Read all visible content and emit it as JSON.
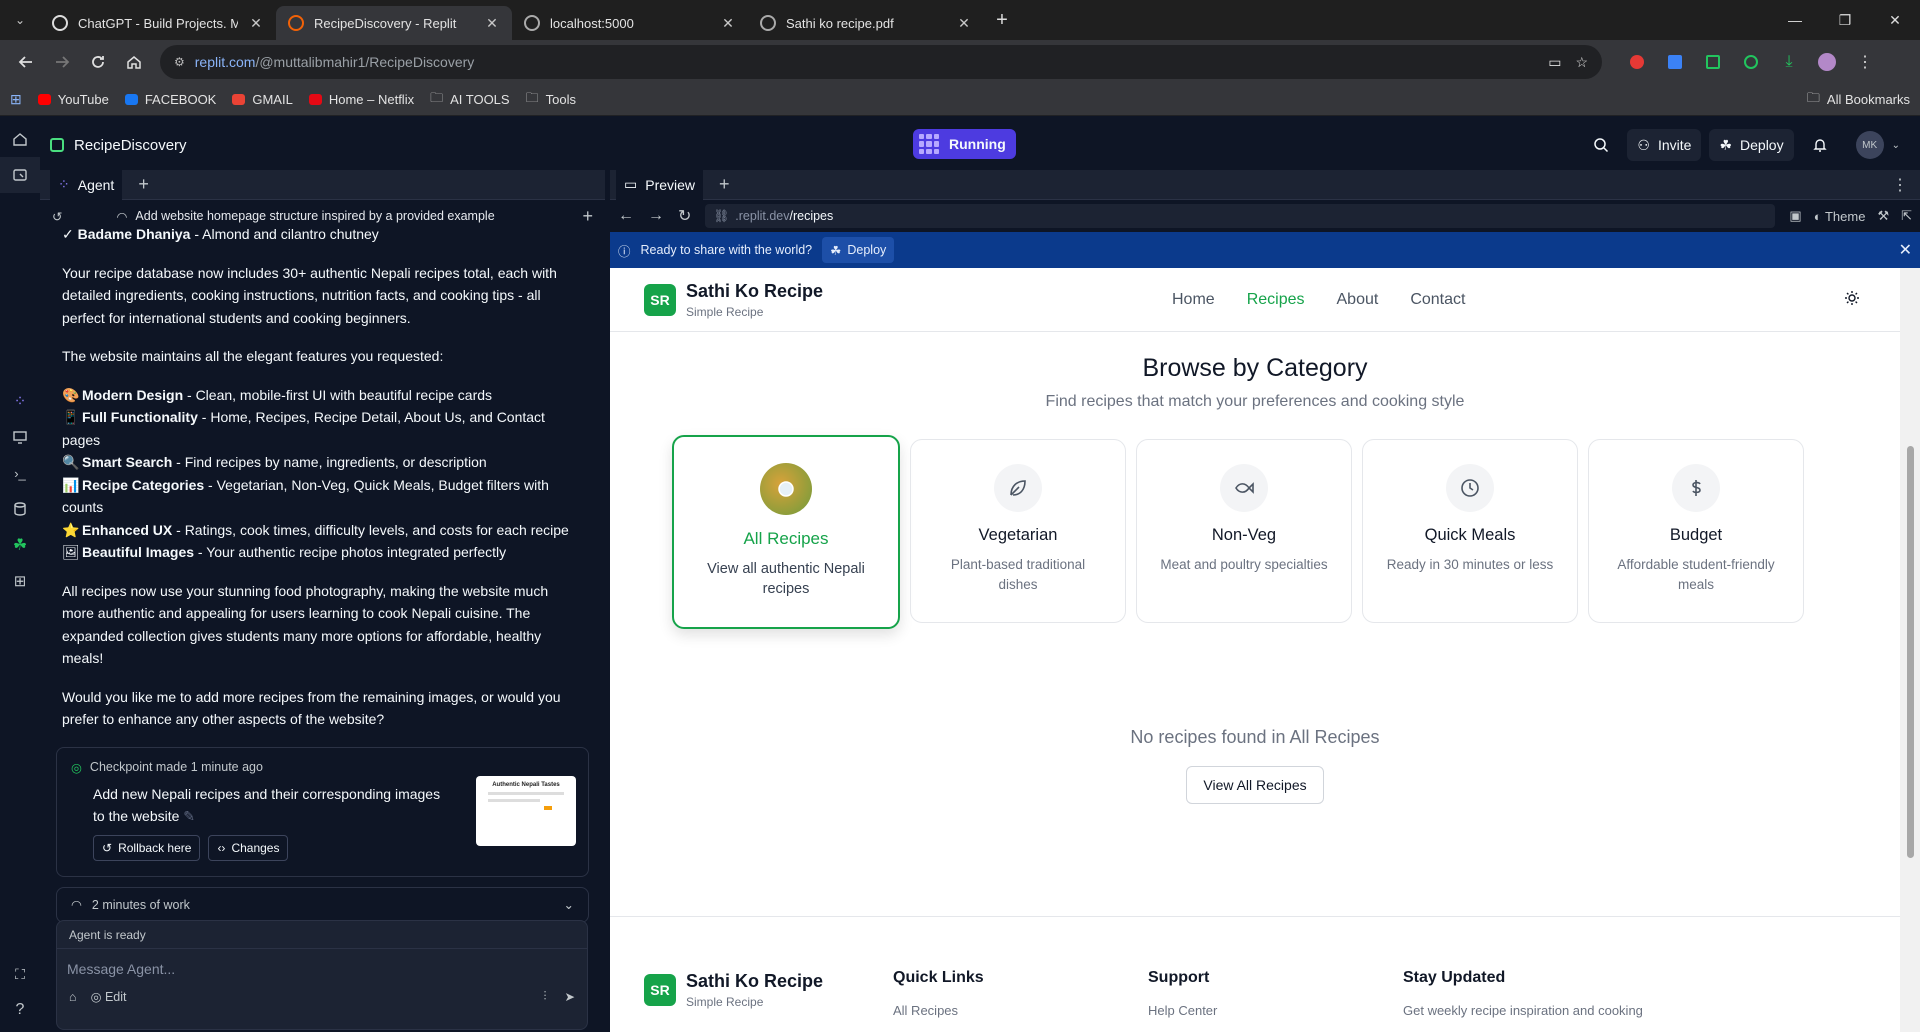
{
  "browser": {
    "tabs": [
      {
        "title": "ChatGPT - Build Projects. Mahir",
        "active": false,
        "favicon": "chatgpt-icon"
      },
      {
        "title": "RecipeDiscovery - Replit",
        "active": true,
        "favicon": "replit-icon"
      },
      {
        "title": "localhost:5000",
        "active": false,
        "favicon": "globe-icon"
      },
      {
        "title": "Sathi ko recipe.pdf",
        "active": false,
        "favicon": "globe-icon"
      }
    ],
    "url_host": "replit.com",
    "url_path": "/@muttalibmahir1/RecipeDiscovery",
    "bookmarks": [
      {
        "label": "YouTube",
        "icon": "youtube-icon"
      },
      {
        "label": "FACEBOOK",
        "icon": "facebook-icon"
      },
      {
        "label": "GMAIL",
        "icon": "gmail-icon"
      },
      {
        "label": "Home – Netflix",
        "icon": "netflix-icon"
      },
      {
        "label": "AI TOOLS",
        "icon": "folder-icon"
      },
      {
        "label": "Tools",
        "icon": "folder-icon"
      }
    ],
    "all_bookmarks": "All Bookmarks"
  },
  "replit": {
    "project_name": "RecipeDiscovery",
    "status": "Running",
    "invite": "Invite",
    "deploy": "Deploy",
    "avatar": "MK"
  },
  "agent": {
    "tab_label": "Agent",
    "thread_title": "Add website homepage structure inspired by a provided example",
    "message": {
      "first_line_bold": "Badame Dhaniya",
      "first_line_rest": " - Almond and cilantro chutney",
      "p1": "Your recipe database now includes 30+ authentic Nepali recipes total, each with detailed ingredients, cooking instructions, nutrition facts, and cooking tips - all perfect for international students and cooking beginners.",
      "p2": "The website maintains all the elegant features you requested:",
      "features": [
        {
          "emoji": "🎨",
          "title": "Modern Design",
          "text": " - Clean, mobile-first UI with beautiful recipe cards"
        },
        {
          "emoji": "📱",
          "title": "Full Functionality",
          "text": " - Home, Recipes, Recipe Detail, About Us, and Contact pages"
        },
        {
          "emoji": "🔍",
          "title": "Smart Search",
          "text": " - Find recipes by name, ingredients, or description"
        },
        {
          "emoji": "📊",
          "title": "Recipe Categories",
          "text": " - Vegetarian, Non-Veg, Quick Meals, Budget filters with counts"
        },
        {
          "emoji": "⭐",
          "title": "Enhanced UX",
          "text": " - Ratings, cook times, difficulty levels, and costs for each recipe"
        },
        {
          "emoji": "🖼",
          "title": "Beautiful Images",
          "text": " - Your authentic recipe photos integrated perfectly"
        }
      ],
      "p3": "All recipes now use your stunning food photography, making the website much more authentic and appealing for users learning to cook Nepali cuisine. The expanded collection gives students many more options for affordable, healthy meals!",
      "p4": "Would you like me to add more recipes from the remaining images, or would you prefer to enhance any other aspects of the website?"
    },
    "checkpoint": {
      "label": "Checkpoint made",
      "time": "1 minute ago",
      "text": "Add new Nepali recipes and their corresponding images to the website",
      "rollback": "Rollback here",
      "changes": "Changes",
      "thumb_title": "Authentic Nepali Tastes"
    },
    "work": "2 minutes of work",
    "ready": "Agent is ready",
    "input_placeholder": "Message Agent...",
    "edit": "Edit"
  },
  "preview": {
    "tab_label": "Preview",
    "url_prefix": ".replit.dev",
    "url_path": "/recipes",
    "theme": "Theme",
    "banner_text": "Ready to share with the world?",
    "banner_deploy": "Deploy"
  },
  "site": {
    "logo": "SR",
    "name": "Sathi Ko Recipe",
    "tagline": "Simple Recipe",
    "nav": [
      {
        "label": "Home",
        "active": false
      },
      {
        "label": "Recipes",
        "active": true
      },
      {
        "label": "About",
        "active": false
      },
      {
        "label": "Contact",
        "active": false
      }
    ],
    "browse_title": "Browse by Category",
    "browse_subtitle": "Find recipes that match your preferences and cooking style",
    "categories": [
      {
        "title": "All Recipes",
        "desc": "View all authentic Nepali recipes",
        "icon": "plate-icon",
        "selected": true
      },
      {
        "title": "Vegetarian",
        "desc": "Plant-based traditional dishes",
        "icon": "leaf-icon",
        "selected": false
      },
      {
        "title": "Non-Veg",
        "desc": "Meat and poultry specialties",
        "icon": "fish-icon",
        "selected": false
      },
      {
        "title": "Quick Meals",
        "desc": "Ready in 30 minutes or less",
        "icon": "clock-icon",
        "selected": false
      },
      {
        "title": "Budget",
        "desc": "Affordable student-friendly meals",
        "icon": "dollar-icon",
        "selected": false
      }
    ],
    "empty_text": "No recipes found in All Recipes",
    "view_all": "View All Recipes",
    "footer": {
      "quick_links": "Quick Links",
      "quick_link_1": "All Recipes",
      "support": "Support",
      "support_1": "Help Center",
      "stay_updated": "Stay Updated",
      "stay_text": "Get weekly recipe inspiration and cooking"
    }
  },
  "colors": {
    "accent_green": "#16a34a",
    "running_purple": "#4d3be0",
    "banner_blue": "#0b3a8c"
  }
}
